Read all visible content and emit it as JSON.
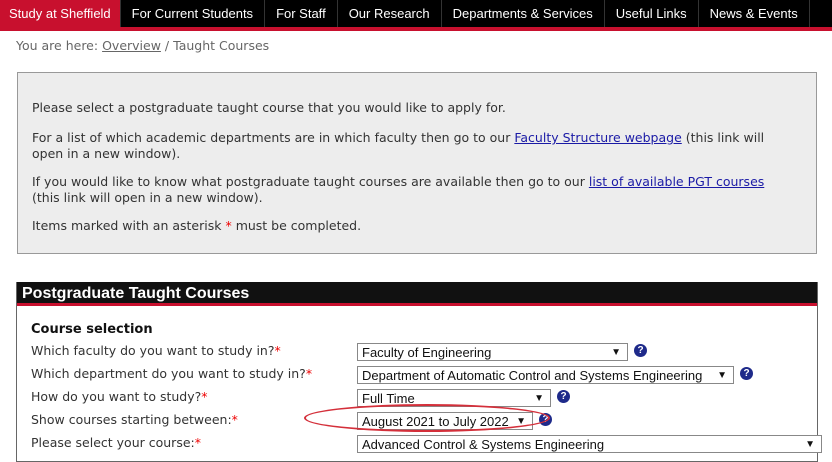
{
  "nav": {
    "items": [
      "Study at Sheffield",
      "For Current Students",
      "For Staff",
      "Our Research",
      "Departments & Services",
      "Useful Links",
      "News & Events"
    ]
  },
  "breadcrumb": {
    "prefix": "You are here:",
    "link": "Overview",
    "separator": "/",
    "current": "Taught Courses"
  },
  "info": {
    "line1": "Please select a postgraduate taught course that you would like to apply for.",
    "line2_pre": "For a list of which academic departments are in which faculty then go to our ",
    "line2_link": "Faculty Structure webpage",
    "line2_post": " (this link will open in a new window).",
    "line3_pre": "If you would like to know what postgraduate taught courses are available then go to our ",
    "line3_link": "list of available PGT courses",
    "line3_post": " (this link will open in a new window).",
    "line4_pre": "Items marked with an asterisk ",
    "line4_star": "*",
    "line4_post": " must be completed."
  },
  "panel": {
    "title": "Postgraduate Taught Courses",
    "section": "Course selection",
    "asterisk": "*",
    "help_glyph": "?",
    "caret": "▼",
    "fields": [
      {
        "label": "Which faculty do you want to study in?",
        "value": "Faculty of Engineering"
      },
      {
        "label": "Which department do you want to study in?",
        "value": "Department of Automatic Control and Systems Engineering"
      },
      {
        "label": "How do you want to study?",
        "value": "Full Time"
      },
      {
        "label": "Show courses starting between:",
        "value": "August 2021 to July 2022"
      },
      {
        "label": "Please select your course:",
        "value": "Advanced Control & Systems Engineering"
      }
    ]
  },
  "colors": {
    "accent_red": "#c8102e",
    "nav_bg": "#000000",
    "link_blue": "#1a1aa6",
    "help_blue": "#1e2a8a",
    "highlight_ellipse": "#d42f3a"
  }
}
